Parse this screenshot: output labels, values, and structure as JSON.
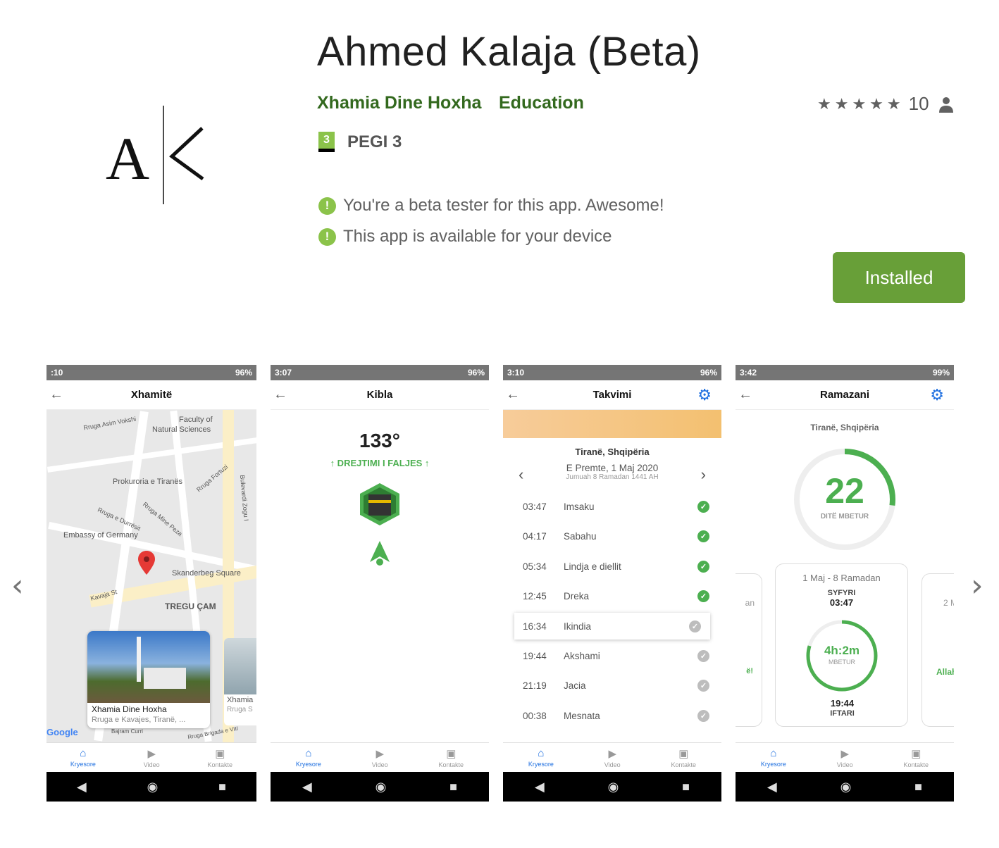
{
  "app": {
    "title": "Ahmed Kalaja (Beta)",
    "developer": "Xhamia Dine Hoxha",
    "category": "Education",
    "rating_count": "10",
    "pegi_number": "3",
    "pegi_label": "PEGI 3",
    "notes": [
      "You're a beta tester for this app. Awesome!",
      "This app is available for your device"
    ],
    "install_label": "Installed",
    "logo_letters": "A|K",
    "stars": 5
  },
  "colors": {
    "accent_green": "#689f38",
    "link_green": "#33691e",
    "blue": "#1e6fe0"
  },
  "common": {
    "nav": [
      "Kryesore",
      "Video",
      "Kontakte"
    ]
  },
  "screens": [
    {
      "status_time": ":10",
      "status_batt": "96%",
      "title": "Xhamitë",
      "map_labels": [
        "Rruga Asim Vokshi",
        "Faculty of",
        "Natural Sciences",
        "Prokuroria e Tiranës",
        "Rruga Fortuzi",
        "Bulevardi Zogu I",
        "Rruga e Durrësit",
        "Rruga Mine Peza",
        "Embassy of Germany",
        "Skanderbeg Square",
        "Kavaja St",
        "TREGU ÇAM",
        "Google",
        "Rruga Brigada e VIII",
        "Bajram Curri"
      ],
      "card_title": "Xhamia Dine Hoxha",
      "card_sub": "Rruga e Kavajes, Tiranë, ...",
      "card2_title": "Xhamia",
      "card2_sub": "Rruga S"
    },
    {
      "status_time": "3:07",
      "status_batt": "96%",
      "title": "Kibla",
      "degrees": "133°",
      "direction": "↑ DREJTIMI I FALJES ↑"
    },
    {
      "status_time": "3:10",
      "status_batt": "96%",
      "title": "Takvimi",
      "location": "Tiranë, Shqipëria",
      "date": "E Premte, 1 Maj 2020",
      "hijri": "Jumuah 8 Ramadan 1441 AH",
      "prayers": [
        {
          "time": "03:47",
          "name": "Imsaku",
          "done": true
        },
        {
          "time": "04:17",
          "name": "Sabahu",
          "done": true
        },
        {
          "time": "05:34",
          "name": "Lindja e diellit",
          "done": true
        },
        {
          "time": "12:45",
          "name": "Dreka",
          "done": true
        },
        {
          "time": "16:34",
          "name": "Ikindia",
          "done": false
        },
        {
          "time": "19:44",
          "name": "Akshami",
          "done": false
        },
        {
          "time": "21:19",
          "name": "Jacia",
          "done": false
        },
        {
          "time": "00:38",
          "name": "Mesnata",
          "done": false
        }
      ]
    },
    {
      "status_time": "3:42",
      "status_batt": "99%",
      "title": "Ramazani",
      "location": "Tiranë, Shqipëria",
      "days": "22",
      "days_label": "DITË MBETUR",
      "day_progress": 0.27,
      "card_date": "1 Maj - 8 Ramadan",
      "suhoor_label": "SYFYRI",
      "suhoor_time": "03:47",
      "remaining": "4h:2m",
      "remaining_label": "MBETUR",
      "iftar_time": "19:44",
      "iftar_label": "IFTARI",
      "side_left_top": "an",
      "side_left_bottom": "ë!",
      "side_right_top": "2 M",
      "side_right_bottom": "Allah"
    }
  ]
}
